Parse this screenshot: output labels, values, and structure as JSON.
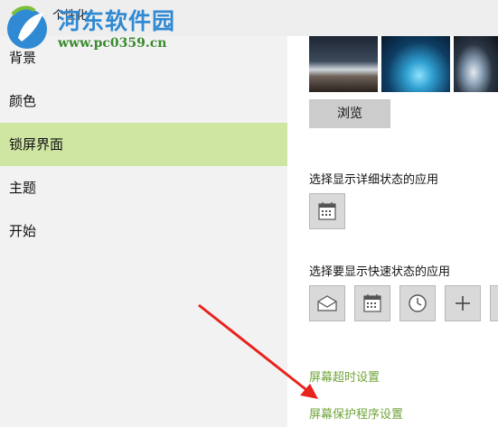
{
  "window": {
    "title": "个性化"
  },
  "sidebar": {
    "items": [
      {
        "label": "背景"
      },
      {
        "label": "颜色"
      },
      {
        "label": "锁屏界面",
        "selected": true
      },
      {
        "label": "主题"
      },
      {
        "label": "开始"
      }
    ]
  },
  "main": {
    "browse_label": "浏览",
    "detailed_status_label": "选择显示详细状态的应用",
    "quick_status_label": "选择要显示快速状态的应用",
    "quick_status_icons": [
      "mail-icon",
      "calendar-icon",
      "alarm-clock-icon",
      "plus-icon",
      "partial-tile"
    ],
    "screen_timeout_link": "屏幕超时设置",
    "screensaver_link": "屏幕保护程序设置"
  },
  "watermark": {
    "text": "河东软件园",
    "url": "www.pc0359.cn"
  },
  "colors": {
    "accent": "#6fa43a",
    "selected_nav": "#cfe6a3",
    "sidebar_bg": "#f2f2f2",
    "watermark_blue": "#2f8ad3",
    "arrow_red": "#e8231e"
  }
}
